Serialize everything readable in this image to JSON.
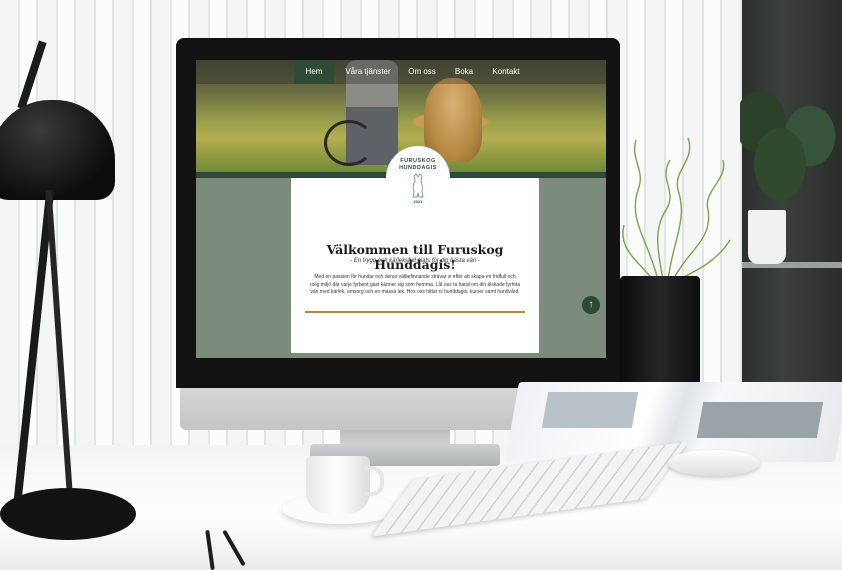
{
  "site": {
    "nav": {
      "items": [
        {
          "label": "Hem",
          "active": true
        },
        {
          "label": "Våra tjänster",
          "active": false
        },
        {
          "label": "Om oss",
          "active": false
        },
        {
          "label": "Boka",
          "active": false
        },
        {
          "label": "Kontakt",
          "active": false
        }
      ]
    },
    "logo": {
      "line1": "FURUSKOG",
      "line2": "HUNDDAGIS",
      "year": "2021"
    },
    "welcome": {
      "title": "Välkommen till Furuskog Hunddagis!",
      "subtitle": "- En trygg och kärleksfull plats för din bästa vän -",
      "body": "Med en passion för hundar och deras välbefinnande strävar vi efter att skapa en fridfull och rolig miljö där varje fyrbent gäst känner sig som hemma. Låt oss ta hand om din älskade fyrfota vän med kärlek, omsorg och en massa lek. Hos oss hittar ni hunddagis, kurser samt hundvård."
    },
    "scroll_top_icon": "arrow-up-icon",
    "colors": {
      "primary_green": "#2c4a33",
      "sage_background": "#7d8b7c",
      "gold_accent": "#b08a3e"
    }
  }
}
